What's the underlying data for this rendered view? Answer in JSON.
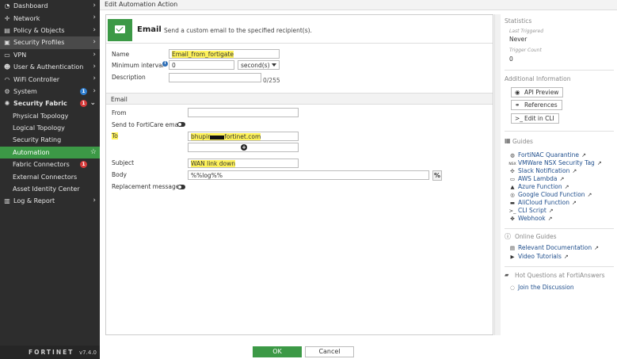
{
  "sidebar": {
    "items": [
      {
        "label": "Dashboard",
        "icon": "dashboard-icon"
      },
      {
        "label": "Network",
        "icon": "network-icon"
      },
      {
        "label": "Policy & Objects",
        "icon": "policy-icon"
      },
      {
        "label": "Security Profiles",
        "icon": "lock-icon"
      },
      {
        "label": "VPN",
        "icon": "vpn-icon"
      },
      {
        "label": "User & Authentication",
        "icon": "user-icon"
      },
      {
        "label": "WiFi Controller",
        "icon": "wifi-icon"
      },
      {
        "label": "System",
        "icon": "gear-icon",
        "badge": "1"
      },
      {
        "label": "Security Fabric",
        "icon": "fabric-icon",
        "badge": "1"
      },
      {
        "label": "Physical Topology"
      },
      {
        "label": "Logical Topology"
      },
      {
        "label": "Security Rating"
      },
      {
        "label": "Automation"
      },
      {
        "label": "Fabric Connectors",
        "badge": "1"
      },
      {
        "label": "External Connectors"
      },
      {
        "label": "Asset Identity Center"
      },
      {
        "label": "Log & Report",
        "icon": "log-icon"
      }
    ],
    "logo": "FORTINET",
    "version": "v7.4.0"
  },
  "page": {
    "title": "Edit Automation Action"
  },
  "action": {
    "name": "Email",
    "description": "Send a custom email to the specified recipient(s)."
  },
  "form": {
    "name_label": "Name",
    "name_value": "Email_from_fortigate",
    "interval_label": "Minimum interval",
    "interval_value": "0",
    "interval_unit": "second(s)",
    "description_label": "Description",
    "description_counter": "0/255",
    "email_section": "Email",
    "from_label": "From",
    "fortiCare_label": "Send to FortiCare email",
    "to_label": "To",
    "to_value_a": "bhupir",
    "to_value_b": "fortinet.com",
    "subject_label": "Subject",
    "subject_value": "WAN link down",
    "body_label": "Body",
    "body_value": "%%log%%",
    "body_button": "%",
    "replacement_label": "Replacement message"
  },
  "right": {
    "statistics": "Statistics",
    "last_triggered_label": "Last Triggered",
    "last_triggered_value": "Never",
    "trigger_count_label": "Trigger Count",
    "trigger_count_value": "0",
    "additional": "Additional Information",
    "api_preview": "API Preview",
    "references": "References",
    "edit_cli": "Edit in CLI",
    "guides_title": "Guides",
    "guides": [
      {
        "label": "FortiNAC Quarantine",
        "icon": "fortinac-icon"
      },
      {
        "label": "VMWare NSX Security Tag",
        "icon": "nsx-icon",
        "glyph": "NSX"
      },
      {
        "label": "Slack Notification",
        "icon": "slack-icon"
      },
      {
        "label": "AWS Lambda",
        "icon": "aws-icon"
      },
      {
        "label": "Azure Function",
        "icon": "azure-icon"
      },
      {
        "label": "Google Cloud Function",
        "icon": "gcloud-icon"
      },
      {
        "label": "AliCloud Function",
        "icon": "alicloud-icon"
      },
      {
        "label": "CLI Script",
        "icon": "cli-icon",
        "glyph": ">_"
      },
      {
        "label": "Webhook",
        "icon": "webhook-icon"
      }
    ],
    "online_title": "Online Guides",
    "online": [
      {
        "label": "Relevant Documentation",
        "icon": "doc-icon"
      },
      {
        "label": "Video Tutorials",
        "icon": "video-icon"
      }
    ],
    "answers_title": "Hot Questions at FortiAnswers",
    "join": "Join the Discussion"
  },
  "footer": {
    "ok": "OK",
    "cancel": "Cancel"
  }
}
